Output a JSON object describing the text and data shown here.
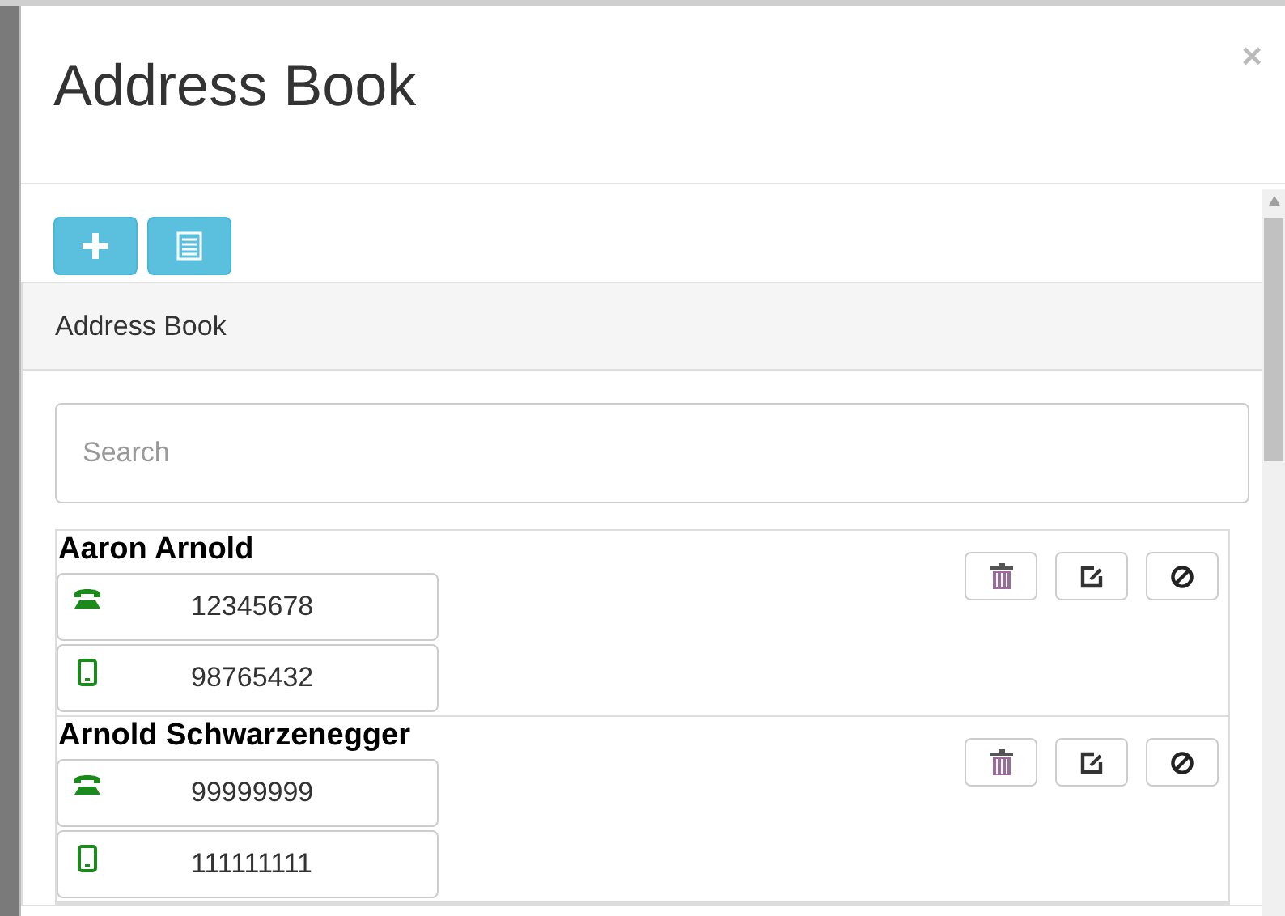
{
  "dialog": {
    "title": "Address Book",
    "close": "×"
  },
  "panel": {
    "heading": "Address Book"
  },
  "search": {
    "placeholder": "Search"
  },
  "contacts": [
    {
      "name": "Aaron Arnold",
      "phones": [
        {
          "kind": "landline",
          "number": "12345678"
        },
        {
          "kind": "mobile",
          "number": "98765432"
        }
      ]
    },
    {
      "name": "Arnold Schwarzenegger",
      "phones": [
        {
          "kind": "landline",
          "number": "99999999"
        },
        {
          "kind": "mobile",
          "number": "111111111"
        }
      ]
    }
  ]
}
